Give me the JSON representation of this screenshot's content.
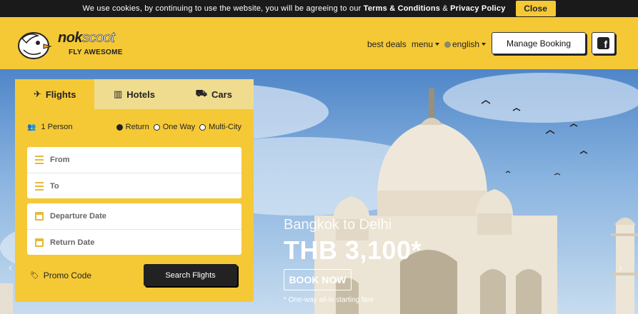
{
  "cookie_bar": {
    "text_before": "We use cookies, by continuing to use the website, you will be agreeing to our ",
    "terms_link": "Terms & Conditions",
    "connector": " & ",
    "privacy_link": "Privacy Policy",
    "close_label": "Close"
  },
  "header": {
    "logo_word_1": "nok",
    "logo_word_2": "scoot",
    "logo_tagline": "FLY AWESOME",
    "nav": {
      "deals": "best deals",
      "menu": "menu",
      "language": "english"
    },
    "manage_booking": "Manage Booking",
    "facebook_icon": "facebook-icon"
  },
  "colors": {
    "brand_yellow": "#f5c936",
    "dark": "#222222",
    "inactive_tab": "#efdc8f"
  },
  "booking": {
    "tabs": [
      {
        "label": "Flights",
        "icon": "plane-icon",
        "active": true
      },
      {
        "label": "Hotels",
        "icon": "building-icon",
        "active": false
      },
      {
        "label": "Cars",
        "icon": "car-icon",
        "active": false
      }
    ],
    "passengers": "1 Person",
    "trip_types": [
      {
        "label": "Return",
        "selected": true
      },
      {
        "label": "One Way",
        "selected": false
      },
      {
        "label": "Multi-City",
        "selected": false
      }
    ],
    "from_placeholder": "From",
    "to_placeholder": "To",
    "departure_placeholder": "Departure Date",
    "return_placeholder": "Return Date",
    "promo_code": "Promo Code",
    "search_button": "Search Flights"
  },
  "hero": {
    "route": "Bangkok to Delhi",
    "price": "THB 3,100*",
    "cta": "BOOK NOW",
    "note": "* One-way all-in starting fare"
  }
}
